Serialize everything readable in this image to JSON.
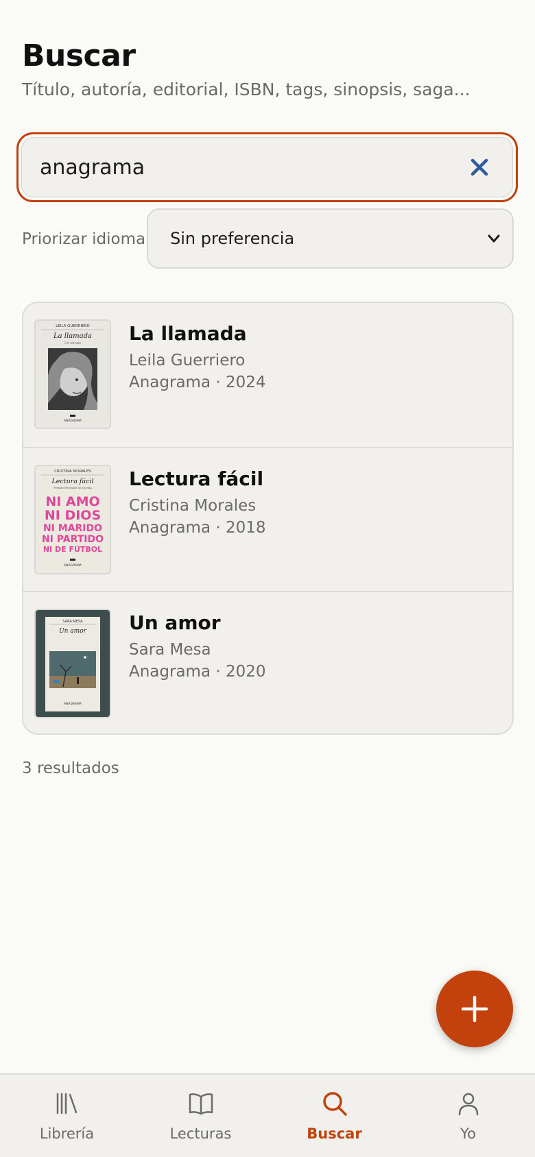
{
  "header": {
    "title": "Buscar",
    "subtitle": "Título, autoría, editorial, ISBN, tags, sinopsis, saga..."
  },
  "search": {
    "value": "anagrama",
    "clear_icon": "close-icon"
  },
  "language": {
    "label": "Priorizar idioma",
    "selected": "Sin preferencia",
    "icon": "chevron-down-icon"
  },
  "results": [
    {
      "title": "La llamada",
      "author": "Leila Guerriero",
      "meta": "Anagrama · 2024",
      "cover": {
        "author": "LEILA GUERRIERO",
        "title": "La llamada",
        "subtitle": "Un retrato",
        "publisher": "ANAGRAMA"
      }
    },
    {
      "title": "Lectura fácil",
      "author": "Cristina Morales",
      "meta": "Anagrama · 2018",
      "cover": {
        "author": "CRISTINA MORALES",
        "title": "Lectura fácil",
        "subtitle": "Premio Herralde de Novela",
        "publisher": "ANAGRAMA",
        "lines": [
          "NI AMO",
          "NI DIOS",
          "NI MARIDO",
          "NI PARTIDO",
          "NI DE FÚTBOL"
        ]
      }
    },
    {
      "title": "Un amor",
      "author": "Sara Mesa",
      "meta": "Anagrama · 2020",
      "cover": {
        "author": "SARA MESA",
        "title": "Un amor",
        "publisher": "ANAGRAMA"
      }
    }
  ],
  "results_count": "3 resultados",
  "fab": {
    "icon": "plus-icon"
  },
  "nav": {
    "items": [
      {
        "label": "Librería",
        "icon": "library-icon",
        "active": false
      },
      {
        "label": "Lecturas",
        "icon": "book-open-icon",
        "active": false
      },
      {
        "label": "Buscar",
        "icon": "search-icon",
        "active": true
      },
      {
        "label": "Yo",
        "icon": "user-icon",
        "active": false
      }
    ]
  },
  "colors": {
    "accent": "#c2410c",
    "clear_icon": "#2f5a9e",
    "background": "#fafaf7",
    "surface": "#f1f0ec"
  }
}
